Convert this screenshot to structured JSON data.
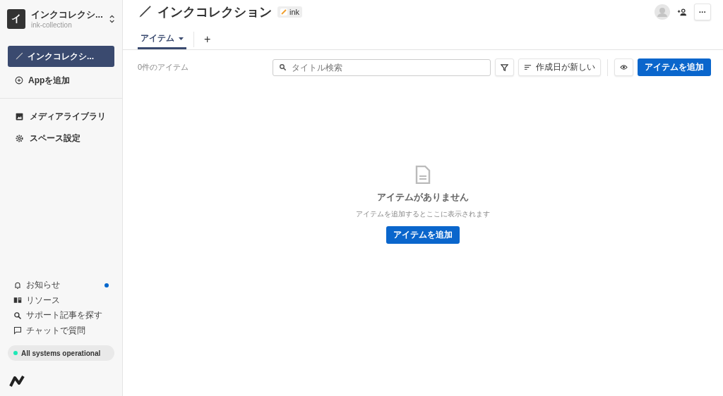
{
  "space": {
    "initial": "イ",
    "name": "インクコレクシ...",
    "slug": "ink-collection"
  },
  "apps": [
    {
      "label": "インクコレクシ...",
      "selected": true
    }
  ],
  "add_app": "Appを追加",
  "nav": [
    {
      "label": "メディアライブラリ",
      "kind": "media"
    },
    {
      "label": "スペース設定",
      "kind": "settings"
    }
  ],
  "footer_links": [
    {
      "label": "お知らせ",
      "kind": "bell",
      "unread": true
    },
    {
      "label": "リソース",
      "kind": "book",
      "unread": false
    },
    {
      "label": "サポート記事を探す",
      "kind": "search",
      "unread": false
    },
    {
      "label": "チャットで質問",
      "kind": "chat",
      "unread": false
    }
  ],
  "status": {
    "label": "All systems operational",
    "color": "#1de9b6"
  },
  "header": {
    "title": "インクコレクション",
    "badge": "ink"
  },
  "tabs": [
    {
      "label": "アイテム",
      "selected": true
    }
  ],
  "add_tab": "+",
  "more": "···",
  "toolbar": {
    "count": "0件のアイテム",
    "search_placeholder": "タイトル検索",
    "sort": "作成日が新しい",
    "add_button": "アイテムを追加"
  },
  "empty": {
    "title": "アイテムがありません",
    "message": "アイテムを追加するとここに表示されます",
    "button": "アイテムを追加"
  }
}
